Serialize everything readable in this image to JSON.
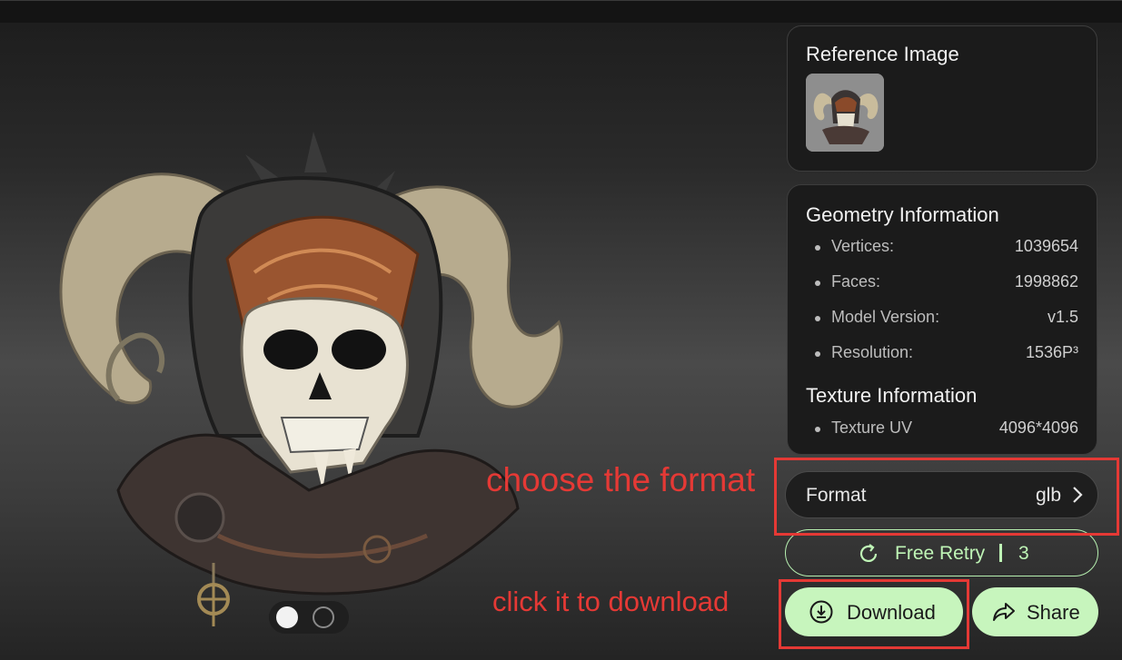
{
  "reference_panel": {
    "title": "Reference Image"
  },
  "geometry_panel": {
    "title": "Geometry Information",
    "rows": [
      {
        "label": "Vertices:",
        "value": "1039654"
      },
      {
        "label": "Faces:",
        "value": "1998862"
      },
      {
        "label": "Model Version:",
        "value": "v1.5"
      },
      {
        "label": "Resolution:",
        "value": "1536P³"
      }
    ],
    "texture_title": "Texture Information",
    "texture_rows": [
      {
        "label": "Texture UV",
        "value": "4096*4096"
      }
    ]
  },
  "format": {
    "label": "Format",
    "value": "glb"
  },
  "retry": {
    "label": "Free Retry",
    "count": "3"
  },
  "download": {
    "label": "Download"
  },
  "share": {
    "label": "Share"
  },
  "annotations": {
    "format_hint": "choose the format",
    "download_hint": "click it to download"
  },
  "colors": {
    "accent_green": "#c7f5bd",
    "annotation_red": "#e53935",
    "panel_bg": "#1b1b1b"
  }
}
